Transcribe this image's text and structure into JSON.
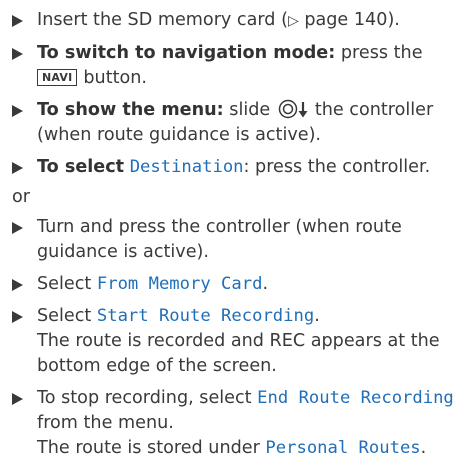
{
  "steps": [
    {
      "pre": "Insert the SD memory card (",
      "page_ref_icon": "small-triangle-right",
      "page_ref": "page 140",
      "post": ")."
    },
    {
      "bold": "To switch to navigation mode:",
      "text_before_key": "press the",
      "key": "NAVI",
      "text_after_key": "button."
    },
    {
      "bold": "To show the menu:",
      "pre": "slide",
      "controller_icon": "controller-slide-down-icon",
      "post": "the controller (when route guidance is active)."
    },
    {
      "bold": "To select",
      "menu_item": "Destination",
      "post": ": press the controller."
    }
  ],
  "or_text": "or",
  "steps2": [
    {
      "text": "Turn and press the controller (when route guidance is active)."
    },
    {
      "pre": "Select",
      "menu_item": "From Memory Card",
      "post": "."
    },
    {
      "pre": "Select",
      "menu_item": "Start Route Recording",
      "post": ".",
      "result": "The route is recorded and REC appears at the bottom edge of the screen."
    },
    {
      "pre": "To stop recording, select",
      "menu_item": "End Route Recording",
      "post": "from the menu.",
      "result_pre": "The route is stored under",
      "result_menu_item": "Personal Routes",
      "result_post": "."
    }
  ],
  "colors": {
    "text": "#3a3a3a",
    "menu_item": "#1f6fb8"
  }
}
